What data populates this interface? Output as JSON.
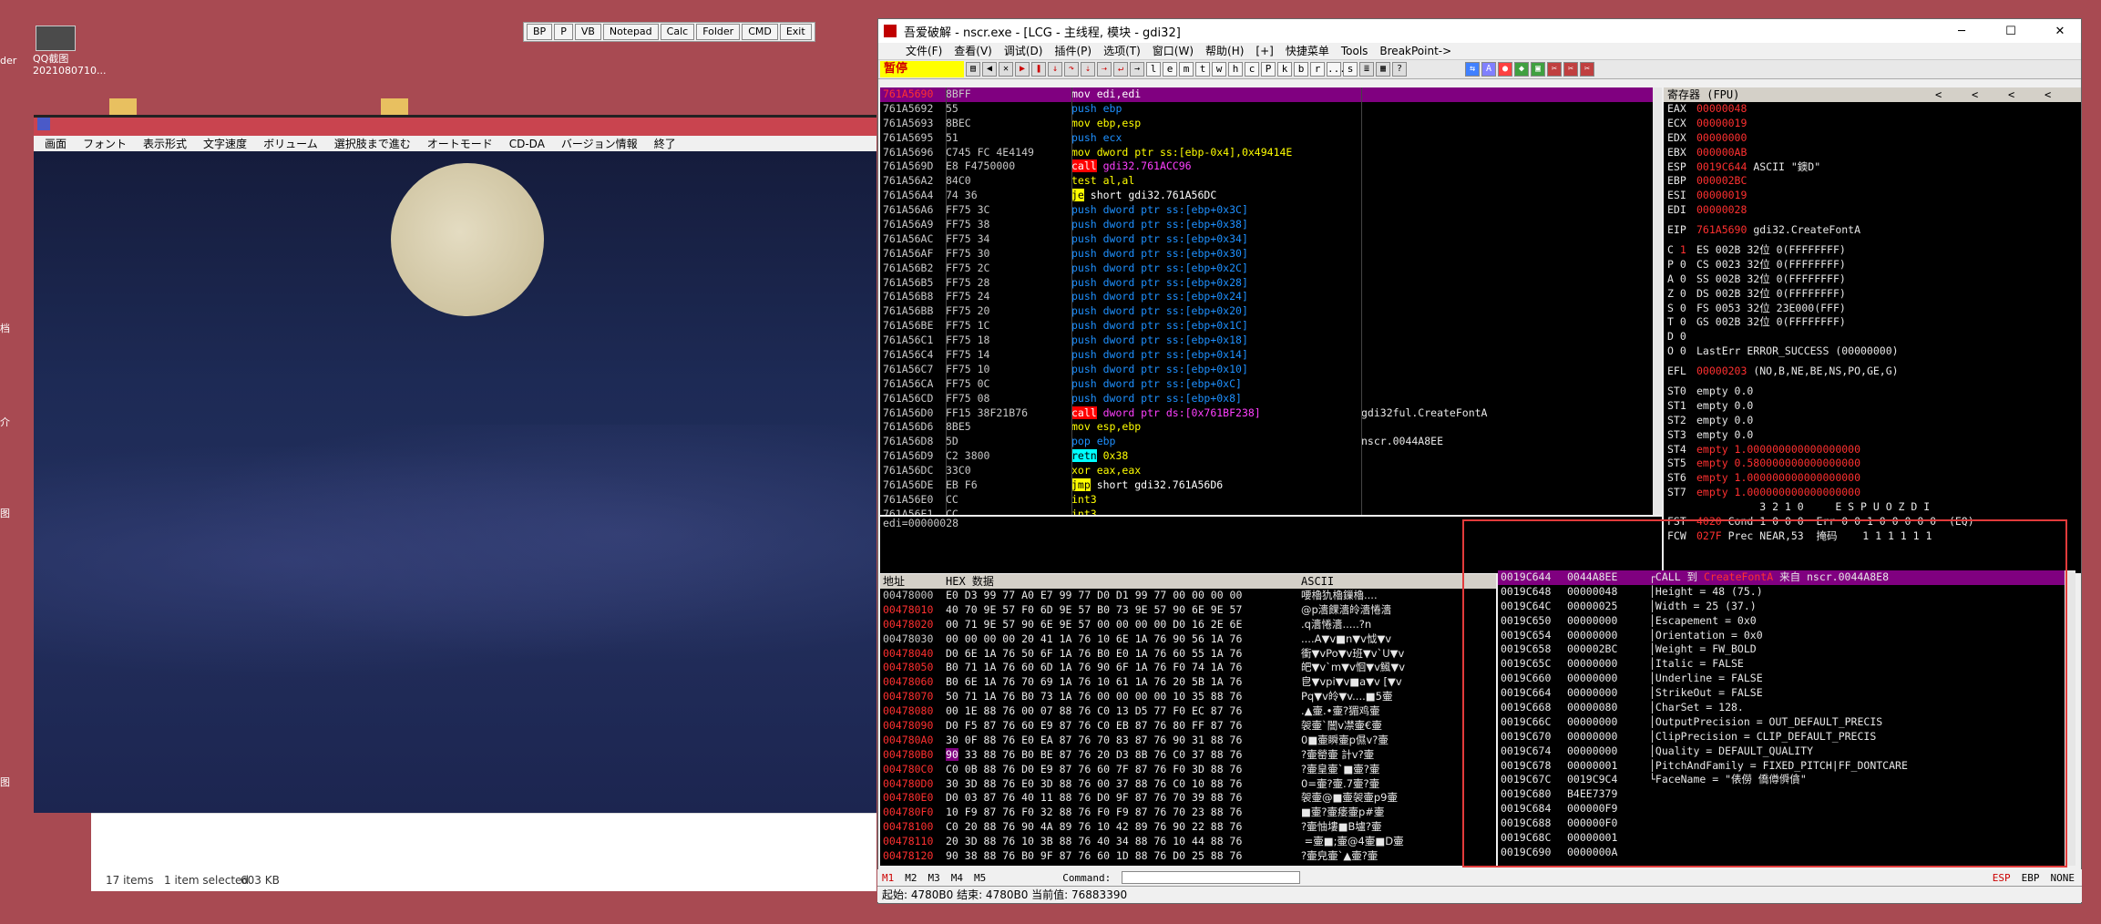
{
  "desktop": {
    "icons": [
      {
        "label": "QQ截图\n2021080710..."
      }
    ],
    "side_labels": [
      "der",
      "档",
      "介",
      "图",
      "图"
    ]
  },
  "launcher": {
    "buttons": [
      "BP",
      "P",
      "VB",
      "Notepad",
      "Calc",
      "Folder",
      "CMD",
      "Exit"
    ]
  },
  "game": {
    "menu": [
      "画面",
      "フォント",
      "表示形式",
      "文字速度",
      "ボリューム",
      "選択肢まで進む",
      "オートモード",
      "CD-DA",
      "バージョン情報",
      "終了"
    ],
    "explorer_status": {
      "items": "17 items",
      "selected": "1 item selected",
      "size": "603 KB"
    }
  },
  "debugger": {
    "title": "吾爱破解 - nscr.exe - [LCG - 主线程, 模块 - gdi32]",
    "menu": [
      "文件(F)",
      "查看(V)",
      "调试(D)",
      "插件(P)",
      "选项(T)",
      "窗口(W)",
      "帮助(H)",
      "[+]",
      "快捷菜单",
      "Tools",
      "BreakPoint->"
    ],
    "status_text": "暂停",
    "toolbar_letters": [
      "l",
      "e",
      "m",
      "t",
      "w",
      "h",
      "c",
      "P",
      "k",
      "b",
      "r",
      "...",
      "s"
    ],
    "disasm": [
      {
        "addr": "761A5690",
        "hex": "8BFF",
        "asm": "mov edi,edi",
        "kind": "hl"
      },
      {
        "addr": "761A5692",
        "hex": "55",
        "asm": "push ebp",
        "kind": "push"
      },
      {
        "addr": "761A5693",
        "hex": "8BEC",
        "asm": "mov ebp,esp",
        "kind": ""
      },
      {
        "addr": "761A5695",
        "hex": "51",
        "asm": "push ecx",
        "kind": "push"
      },
      {
        "addr": "761A5696",
        "hex": "C745 FC 4E4149",
        "asm": "mov dword ptr ss:[ebp-0x4],0x49414E",
        "kind": ""
      },
      {
        "addr": "761A569D",
        "hex": "E8 F4750000",
        "asm": "call gdi32.761ACC96",
        "kind": "call"
      },
      {
        "addr": "761A56A2",
        "hex": "84C0",
        "asm": "test al,al",
        "kind": ""
      },
      {
        "addr": "761A56A4",
        "hex": "74 36",
        "asm": "je short gdi32.761A56DC",
        "kind": "jmp"
      },
      {
        "addr": "761A56A6",
        "hex": "FF75 3C",
        "asm": "push dword ptr ss:[ebp+0x3C]",
        "kind": "push"
      },
      {
        "addr": "761A56A9",
        "hex": "FF75 38",
        "asm": "push dword ptr ss:[ebp+0x38]",
        "kind": "push"
      },
      {
        "addr": "761A56AC",
        "hex": "FF75 34",
        "asm": "push dword ptr ss:[ebp+0x34]",
        "kind": "push"
      },
      {
        "addr": "761A56AF",
        "hex": "FF75 30",
        "asm": "push dword ptr ss:[ebp+0x30]",
        "kind": "push"
      },
      {
        "addr": "761A56B2",
        "hex": "FF75 2C",
        "asm": "push dword ptr ss:[ebp+0x2C]",
        "kind": "push"
      },
      {
        "addr": "761A56B5",
        "hex": "FF75 28",
        "asm": "push dword ptr ss:[ebp+0x28]",
        "kind": "push"
      },
      {
        "addr": "761A56B8",
        "hex": "FF75 24",
        "asm": "push dword ptr ss:[ebp+0x24]",
        "kind": "push"
      },
      {
        "addr": "761A56BB",
        "hex": "FF75 20",
        "asm": "push dword ptr ss:[ebp+0x20]",
        "kind": "push"
      },
      {
        "addr": "761A56BE",
        "hex": "FF75 1C",
        "asm": "push dword ptr ss:[ebp+0x1C]",
        "kind": "push"
      },
      {
        "addr": "761A56C1",
        "hex": "FF75 18",
        "asm": "push dword ptr ss:[ebp+0x18]",
        "kind": "push"
      },
      {
        "addr": "761A56C4",
        "hex": "FF75 14",
        "asm": "push dword ptr ss:[ebp+0x14]",
        "kind": "push"
      },
      {
        "addr": "761A56C7",
        "hex": "FF75 10",
        "asm": "push dword ptr ss:[ebp+0x10]",
        "kind": "push"
      },
      {
        "addr": "761A56CA",
        "hex": "FF75 0C",
        "asm": "push dword ptr ss:[ebp+0xC]",
        "kind": "push"
      },
      {
        "addr": "761A56CD",
        "hex": "FF75 08",
        "asm": "push dword ptr ss:[ebp+0x8]",
        "kind": "push"
      },
      {
        "addr": "761A56D0",
        "hex": "FF15 38F21B76",
        "asm": "call dword ptr ds:[0x761BF238]",
        "kind": "call",
        "comment": "gdi32ful.CreateFontA"
      },
      {
        "addr": "761A56D6",
        "hex": "8BE5",
        "asm": "mov esp,ebp",
        "kind": ""
      },
      {
        "addr": "761A56D8",
        "hex": "5D",
        "asm": "pop ebp",
        "kind": "push",
        "comment": "nscr.0044A8EE"
      },
      {
        "addr": "761A56D9",
        "hex": "C2 3800",
        "asm": "retn 0x38",
        "kind": "ret"
      },
      {
        "addr": "761A56DC",
        "hex": "33C0",
        "asm": "xor eax,eax",
        "kind": ""
      },
      {
        "addr": "761A56DE",
        "hex": "EB F6",
        "asm": "jmp short gdi32.761A56D6",
        "kind": "jmp"
      },
      {
        "addr": "761A56E0",
        "hex": "CC",
        "asm": "int3",
        "kind": ""
      },
      {
        "addr": "761A56E1",
        "hex": "CC",
        "asm": "int3",
        "kind": ""
      }
    ],
    "info_line": "edi=00000028",
    "registers": {
      "title": "寄存器 (FPU)",
      "lines": [
        [
          "EAX",
          "00000048",
          ""
        ],
        [
          "ECX",
          "00000019",
          ""
        ],
        [
          "EDX",
          "00000000",
          ""
        ],
        [
          "EBX",
          "000000AB",
          ""
        ],
        [
          "ESP",
          "0019C644",
          "ASCII \"鐭D\""
        ],
        [
          "EBP",
          "000002BC",
          ""
        ],
        [
          "ESI",
          "00000019",
          ""
        ],
        [
          "EDI",
          "00000028",
          ""
        ],
        [
          "",
          "",
          " "
        ],
        [
          "EIP",
          "761A5690",
          "gdi32.CreateFontA"
        ],
        [
          "",
          "",
          " "
        ],
        [
          "C 1",
          "ES 002B 32位 0(FFFFFFFF)",
          ""
        ],
        [
          "P 0",
          "CS 0023 32位 0(FFFFFFFF)",
          ""
        ],
        [
          "A 0",
          "SS 002B 32位 0(FFFFFFFF)",
          ""
        ],
        [
          "Z 0",
          "DS 002B 32位 0(FFFFFFFF)",
          ""
        ],
        [
          "S 0",
          "FS 0053 32位 23E000(FFF)",
          ""
        ],
        [
          "T 0",
          "GS 002B 32位 0(FFFFFFFF)",
          ""
        ],
        [
          "D 0",
          "",
          ""
        ],
        [
          "O 0",
          "LastErr ERROR_SUCCESS (00000000)",
          ""
        ],
        [
          "",
          "",
          " "
        ],
        [
          "EFL",
          "00000203",
          "(NO,B,NE,BE,NS,PO,GE,G)"
        ],
        [
          "",
          "",
          " "
        ],
        [
          "ST0",
          "empty 0.0",
          ""
        ],
        [
          "ST1",
          "empty 0.0",
          ""
        ],
        [
          "ST2",
          "empty 0.0",
          ""
        ],
        [
          "ST3",
          "empty 0.0",
          ""
        ],
        [
          "ST4",
          "empty 1.000000000000000000",
          ""
        ],
        [
          "ST5",
          "empty 0.580000000000000000",
          ""
        ],
        [
          "ST6",
          "empty 1.000000000000000000",
          ""
        ],
        [
          "ST7",
          "empty 1.000000000000000000",
          ""
        ],
        [
          "",
          "          3 2 1 0     E S P U O Z D I",
          ""
        ],
        [
          "FST",
          "4020",
          "Cond 1 0 0 0  Err 0 0 1 0 0 0 0 0  (EQ)"
        ],
        [
          "FCW",
          "027F",
          "Prec NEAR,53  掩码    1 1 1 1 1 1"
        ]
      ]
    },
    "dump": {
      "headers": [
        "地址",
        "HEX 数据",
        "ASCII"
      ],
      "rows": [
        [
          "00478000",
          "E0 D3 99 77 A0 E7 99 77 D0 D1 99 77 00 00 00 00",
          "喓櫓犰櫓鏁櫓...."
        ],
        [
          "00478010",
          "40 70 9E 57 F0 6D 9E 57 B0 73 9E 57 90 6E 9E 57",
          "@p瀒餜瀒皊瀒惓瀒"
        ],
        [
          "00478020",
          "00 71 9E 57 90 6E 9E 57 00 00 00 00 D0 16 2E 6E",
          ".q瀒惓瀒.....?n"
        ],
        [
          "00478030",
          "00 00 00 00 20 41 1A 76 10 6E 1A 76 90 56 1A 76",
          "....A▼v■n▼v怴▼v"
        ],
        [
          "00478040",
          "D0 6E 1A 76 50 6F 1A 76 B0 E0 1A 76 60 55 1A 76",
          "衝▼vPo▼v班▼v`U▼v"
        ],
        [
          "00478050",
          "B0 71 1A 76 60 6D 1A 76 90 6F 1A 76 F0 74 1A 76",
          "皅▼v`m▼v恛▼v鯴▼v"
        ],
        [
          "00478060",
          "B0 6E 1A 76 70 69 1A 76 10 61 1A 76 20 5B 1A 76",
          "皀▼vpi▼v■a▼v [▼v"
        ],
        [
          "00478070",
          "50 71 1A 76 B0 73 1A 76 00 00 00 00 10 35 88 76",
          "Pq▼v皊▼v....■5壷"
        ],
        [
          "00478080",
          "00 1E 88 76 00 07 88 76 C0 13 D5 77 F0 EC 87 76",
          ".▲壷.•壷?猸鸡壷"
        ],
        [
          "00478090",
          "D0 F5 87 76 60 E9 87 76 C0 EB 87 76 80 FF 87 76",
          "袈壷`闇v凚壷€壷"
        ],
        [
          "004780A0",
          "30 0F 88 76 E0 EA 87 76 70 83 87 76 90 31 88 76",
          "0■壷瞬壷p儑v?壷"
        ],
        [
          "004780B0",
          "90 33 88 76 B0 BE 87 76 20 D3 8B 76 C0 37 88 76",
          "?壷罃壷 計v?壷"
        ],
        [
          "004780C0",
          "C0 0B 88 76 D0 E9 87 76 60 7F 87 76 F0 3D 88 76",
          "?壷皇壷`■壷?壷"
        ],
        [
          "004780D0",
          "30 3D 88 76 E0 3D 88 76 00 37 88 76 C0 10 88 76",
          "0=壷?壷.7壷?壷"
        ],
        [
          "004780E0",
          "D0 03 87 76 40 11 88 76 D0 9F 87 76 70 39 88 76",
          "袈壷@■壷袈壷p9壷"
        ],
        [
          "004780F0",
          "10 F9 87 76 F0 32 88 76 F0 F9 87 76 70 23 88 76",
          "■壷?壷痿壷p#壷"
        ],
        [
          "00478100",
          "C0 20 88 76 90 4A 89 76 10 42 89 76 90 22 88 76",
          "?壷怞塿■B壚?壷"
        ],
        [
          "00478110",
          "20 3D 88 76 10 3B 88 76 40 34 88 76 10 44 88 76",
          " =壷■;壷@4壷■D壷"
        ],
        [
          "00478120",
          "90 38 88 76 B0 9F 87 76 60 1D 88 76 D0 25 88 76",
          "?壷皃壷`▲壷?壷"
        ]
      ]
    },
    "stack": {
      "rows": [
        [
          "0019C644",
          "0044A8EE",
          "┌CALL 到 CreateFontA 来自 nscr.0044A8E8"
        ],
        [
          "0019C648",
          "00000048",
          "│Height = 48 (75.)"
        ],
        [
          "0019C64C",
          "00000025",
          "│Width = 25 (37.)"
        ],
        [
          "0019C650",
          "00000000",
          "│Escapement = 0x0"
        ],
        [
          "0019C654",
          "00000000",
          "│Orientation = 0x0"
        ],
        [
          "0019C658",
          "000002BC",
          "│Weight = FW_BOLD"
        ],
        [
          "0019C65C",
          "00000000",
          "│Italic = FALSE"
        ],
        [
          "0019C660",
          "00000000",
          "│Underline = FALSE"
        ],
        [
          "0019C664",
          "00000000",
          "│StrikeOut = FALSE"
        ],
        [
          "0019C668",
          "00000080",
          "│CharSet = 128."
        ],
        [
          "0019C66C",
          "00000000",
          "│OutputPrecision = OUT_DEFAULT_PRECIS"
        ],
        [
          "0019C670",
          "00000000",
          "│ClipPrecision = CLIP_DEFAULT_PRECIS"
        ],
        [
          "0019C674",
          "00000000",
          "│Quality = DEFAULT_QUALITY"
        ],
        [
          "0019C678",
          "00000001",
          "│PitchAndFamily = FIXED_PITCH|FF_DONTCARE"
        ],
        [
          "0019C67C",
          "0019C9C4",
          "└FaceName = \"俵僗 僑僔僢僋\""
        ],
        [
          "0019C680",
          "B4EE7379",
          ""
        ],
        [
          "0019C684",
          "000000F9",
          ""
        ],
        [
          "0019C688",
          "000000F0",
          ""
        ],
        [
          "0019C68C",
          "00000001",
          ""
        ],
        [
          "0019C690",
          "0000000A",
          ""
        ]
      ]
    },
    "cmdbar": {
      "tabs": [
        "M1",
        "M2",
        "M3",
        "M4",
        "M5"
      ],
      "command_label": "Command:",
      "right": [
        "ESP",
        "EBP",
        "NONE"
      ]
    },
    "statusbar": "起始: 4780B0 结束: 4780B0 当前值: 76883390"
  }
}
